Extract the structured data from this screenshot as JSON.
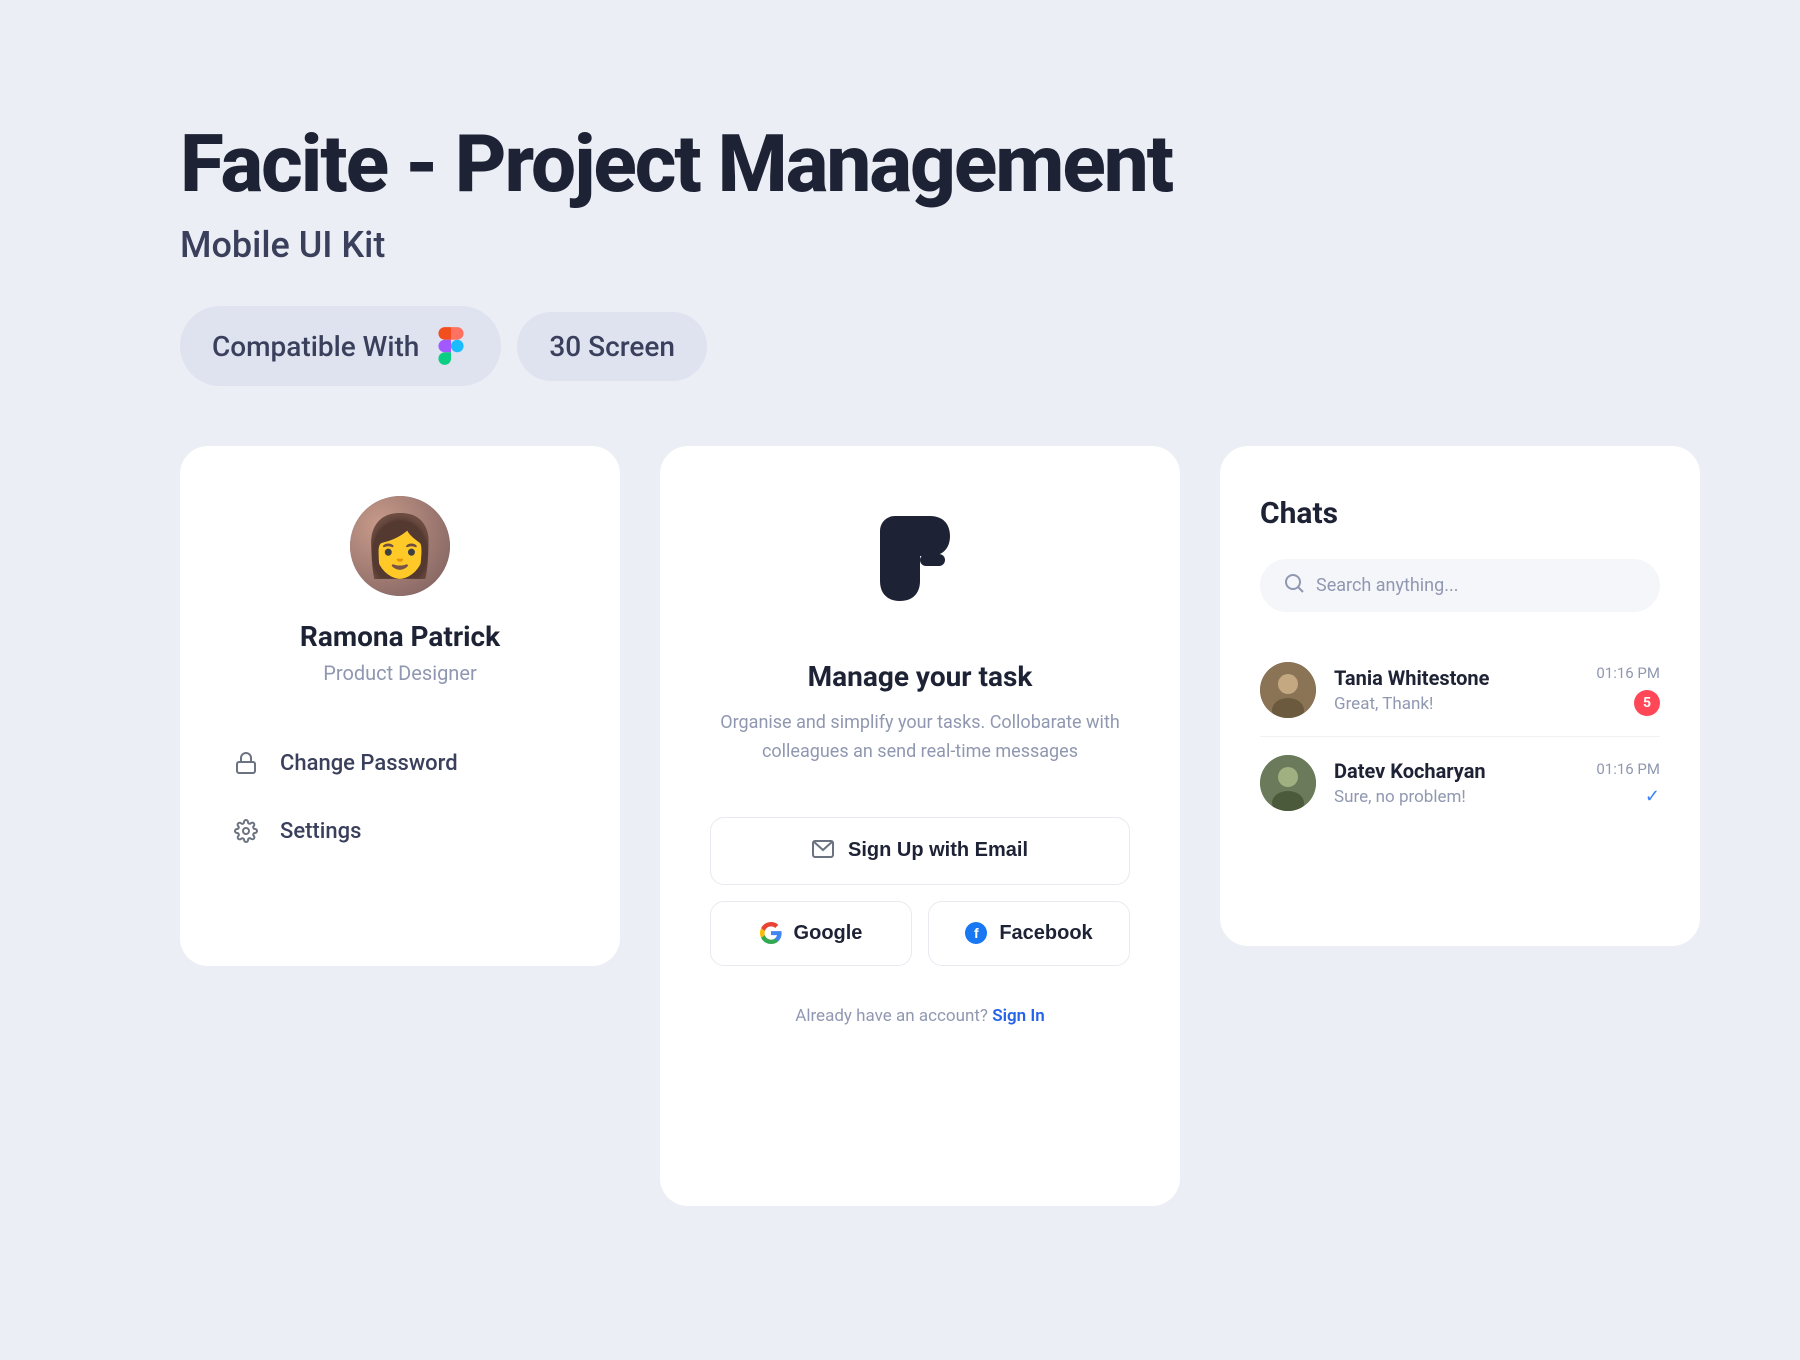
{
  "header": {
    "main_title": "Facite - Project Management",
    "subtitle": "Mobile UI Kit",
    "compatible_label": "Compatible With",
    "screen_count": "30 Screen"
  },
  "profile_card": {
    "name": "Ramona Patrick",
    "role": "Product Designer",
    "menu": [
      {
        "id": "change-password",
        "label": "Change Password",
        "icon": "lock"
      },
      {
        "id": "settings",
        "label": "Settings",
        "icon": "gear"
      }
    ]
  },
  "signup_card": {
    "app_name": "Manage your task",
    "description": "Organise and simplify your tasks.\nCollobarate with colleagues an send\nreal-time messages",
    "buttons": {
      "email": "Sign Up with Email",
      "google": "Google",
      "facebook": "Facebook"
    },
    "already_account": "Already have an account?",
    "sign_in": "Sign In"
  },
  "chats_card": {
    "title": "Chats",
    "search_placeholder": "Search anything...",
    "conversations": [
      {
        "name": "Tania Whitestone",
        "message": "Great, Thank!",
        "time": "01:16 PM",
        "badge": "5",
        "has_badge": true
      },
      {
        "name": "Datev Kocharyan",
        "message": "Sure, no problem!",
        "time": "01:16 PM",
        "badge": "",
        "has_badge": false,
        "has_check": true
      }
    ]
  },
  "colors": {
    "background": "#eceef5",
    "card_bg": "#ffffff",
    "accent": "#2563eb",
    "text_primary": "#1e2235",
    "text_secondary": "#9098b1",
    "badge_bg": "#e8eaf0"
  }
}
